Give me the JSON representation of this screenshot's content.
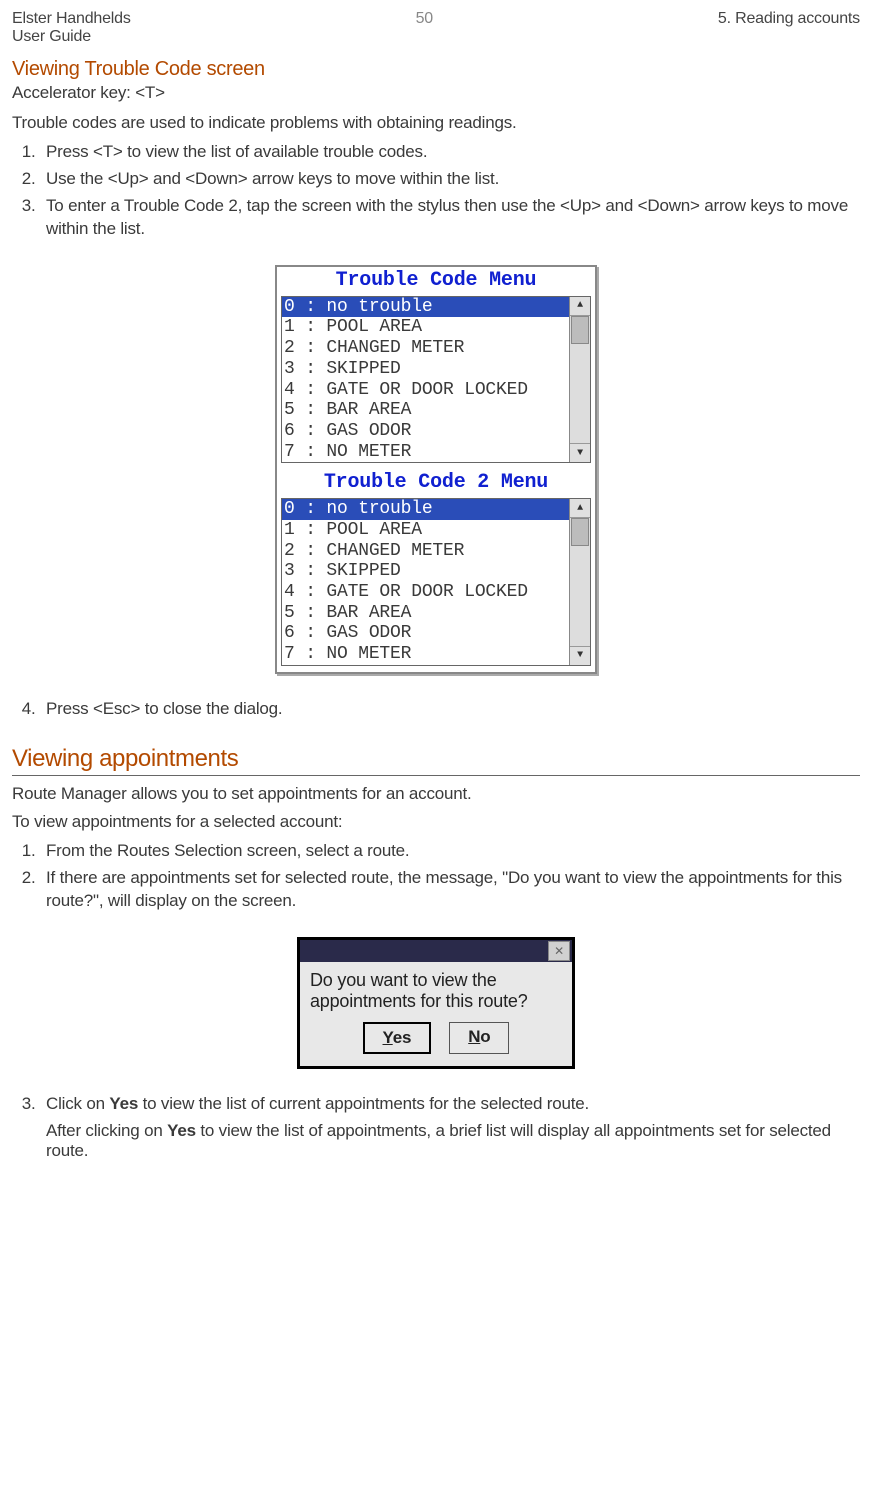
{
  "header": {
    "product": "Elster Handhelds",
    "guide": "User Guide",
    "page": "50",
    "section": "5. Reading accounts"
  },
  "trouble": {
    "title": "Viewing Trouble Code screen",
    "accel": "Accelerator key: <T>",
    "intro": "Trouble codes are used to indicate problems with obtaining readings.",
    "step1": "Press <T> to view the list of available trouble codes.",
    "step2": "Use the <Up> and <Down> arrow keys to move within the list.",
    "step3": "To enter a Trouble Code 2, tap the screen with the stylus then use the <Up> and <Down> arrow keys to move within the list.",
    "step4": "Press <Esc> to close the dialog."
  },
  "screenshot1": {
    "title1": "Trouble Code Menu",
    "title2": "Trouble Code 2 Menu",
    "rows": {
      "r0": "0  : no trouble",
      "r1": "1  : POOL AREA",
      "r2": "2  : CHANGED METER",
      "r3": "3  : SKIPPED",
      "r4": "4  : GATE OR DOOR LOCKED",
      "r5": "5  : BAR AREA",
      "r6": "6  : GAS ODOR",
      "r7": "7  : NO METER"
    }
  },
  "appts": {
    "title": "Viewing appointments",
    "intro": "Route Manager allows you to set appointments for an account.",
    "lead": "To view appointments for a selected account:",
    "step1": "From the Routes Selection screen, select a route.",
    "step2": "If there are appointments set for selected route, the message, \"Do you want to view the appointments for this route?\", will display on the screen.",
    "step3_pre": "Click on ",
    "step3_bold": "Yes",
    "step3_post": " to view the list of current appointments for the selected route.",
    "after_pre": "After clicking on ",
    "after_bold": "Yes",
    "after_post": " to view the list of appointments, a brief list will display all appointments set for selected route."
  },
  "dialog": {
    "text": "Do you want to view the appointments for this route?",
    "yes_u": "Y",
    "yes_rest": "es",
    "no_u": "N",
    "no_rest": "o"
  }
}
